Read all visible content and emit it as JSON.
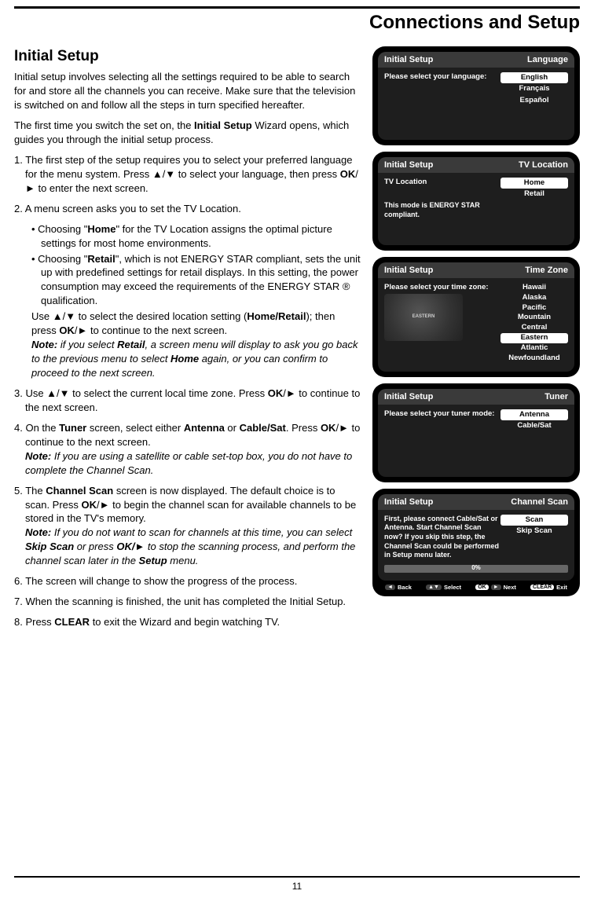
{
  "header": {
    "sectionTitle": "Connections and Setup"
  },
  "footer": {
    "pageNumber": "11"
  },
  "article": {
    "heading": "Initial Setup",
    "intro1": "Initial setup involves selecting all the settings required to be able to search for and store all the channels you can receive. Make sure that the television is switched on and follow all the steps in turn specified hereafter.",
    "intro2_a": "The first time you switch the set on, the ",
    "intro2_b": "Initial Setup",
    "intro2_c": " Wizard opens, which guides you through the initial setup process.",
    "step1_a": "1. The first step of the setup requires you to select your preferred language for the menu system. Press ▲/▼ to select your language, then press ",
    "step1_b": "OK",
    "step1_c": "/► to enter the next screen.",
    "step2_head": "2. A menu screen asks you to set the TV Location.",
    "step2_bullet1_a": "•   Choosing \"",
    "step2_bullet1_b": "Home",
    "step2_bullet1_c": "\" for the TV Location assigns the optimal picture settings for most home environments.",
    "step2_bullet2_a": "•   Choosing \"",
    "step2_bullet2_b": "Retail",
    "step2_bullet2_c": "\", which is not ENERGY STAR compliant, sets the unit up with predefined settings for retail displays. In this setting, the power consumption may exceed the requirements of the ENERGY STAR ® qualification.",
    "step2_use_a": "Use ▲/▼ to select the desired location setting (",
    "step2_use_b": "Home/Retail",
    "step2_use_c": "); then press ",
    "step2_use_d": "OK",
    "step2_use_e": "/► to continue to the next screen.",
    "step2_note_a": "Note:",
    "step2_note_b": " if you select ",
    "step2_note_c": "Retail",
    "step2_note_d": ", a screen menu will display to ask you go back to the previous menu to select ",
    "step2_note_e": "Home",
    "step2_note_f": " again, or you can confirm to proceed to the next screen.",
    "step3_a": "3. Use ▲/▼ to select the current local time zone. Press ",
    "step3_b": "OK",
    "step3_c": "/► to continue to the next screen.",
    "step4_a": "4. On the ",
    "step4_b": "Tuner",
    "step4_c": " screen, select either ",
    "step4_d": "Antenna",
    "step4_e": " or ",
    "step4_f": "Cable/Sat",
    "step4_g": ". Press ",
    "step4_h": "OK",
    "step4_i": "/► to continue to the next screen.",
    "step4_note_a": "Note:",
    "step4_note_b": " If you are using a satellite or cable set-top box, you do not have to complete the Channel Scan.",
    "step5_a": "5. The ",
    "step5_b": "Channel Scan",
    "step5_c": " screen is now displayed. The default choice is to scan. Press ",
    "step5_d": "OK",
    "step5_e": "/► to begin the channel scan for available channels to be stored in the TV's memory.",
    "step5_note_a": "Note:",
    "step5_note_b": " If you do not want to scan for channels at this time, you can select ",
    "step5_note_c": "Skip Scan",
    "step5_note_d": " or press ",
    "step5_note_e": "OK/►",
    "step5_note_f": " to stop the scanning process, and perform the channel scan later in the ",
    "step5_note_g": "Setup",
    "step5_note_h": " menu.",
    "step6": "6. The screen will change to show the progress of the process.",
    "step7": "7. When the scanning is finished, the unit has completed the Initial Setup.",
    "step8_a": "8. Press ",
    "step8_b": "CLEAR",
    "step8_c": " to exit the Wizard and begin watching TV."
  },
  "screens": {
    "lang": {
      "title": "Initial Setup",
      "category": "Language",
      "prompt": "Please select your language:",
      "opts": [
        "English",
        "Français",
        "Español"
      ],
      "selected": "English"
    },
    "loc": {
      "title": "Initial Setup",
      "category": "TV Location",
      "prompt": "TV Location",
      "opts": [
        "Home",
        "Retail"
      ],
      "selected": "Home",
      "note": "This mode is ENERGY STAR compliant."
    },
    "tz": {
      "title": "Initial Setup",
      "category": "Time Zone",
      "prompt": "Please select your time zone:",
      "mapLabel": "EASTERN",
      "opts": [
        "Hawaii",
        "Alaska",
        "Pacific",
        "Mountain",
        "Central",
        "Eastern",
        "Atlantic",
        "Newfoundland"
      ],
      "selected": "Eastern"
    },
    "tuner": {
      "title": "Initial Setup",
      "category": "Tuner",
      "prompt": "Please select your tuner mode:",
      "opts": [
        "Antenna",
        "Cable/Sat"
      ],
      "selected": "Antenna"
    },
    "scan": {
      "title": "Initial Setup",
      "category": "Channel Scan",
      "prompt": "First, please connect Cable/Sat or Antenna. Start Channel Scan now? If you skip this step, the Channel Scan could be performed in Setup menu later.",
      "opts": [
        "Scan",
        "Skip Scan"
      ],
      "selected": "Scan",
      "progress": "0%",
      "nav": {
        "back": "Back",
        "select": "Select",
        "next": "Next",
        "exit": "Exit",
        "ok": "OK",
        "clear": "CLEAR"
      }
    }
  }
}
